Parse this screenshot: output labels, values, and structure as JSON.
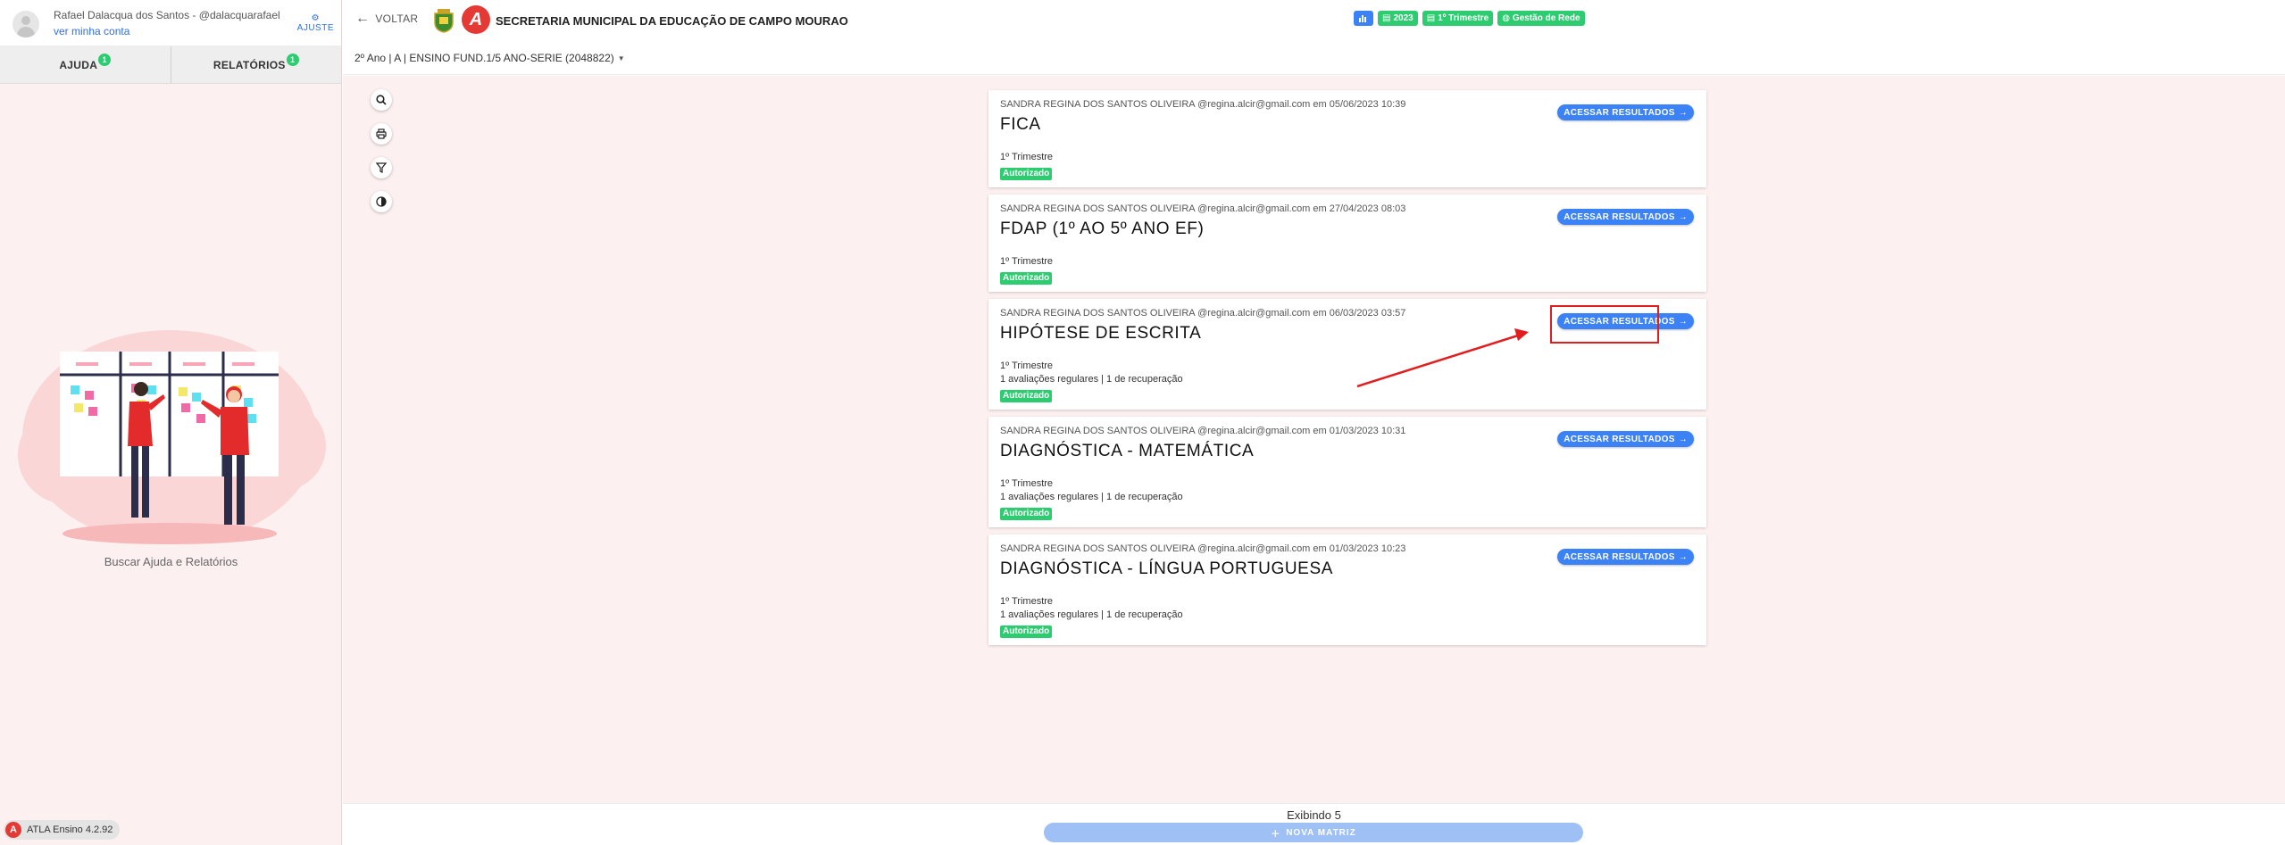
{
  "user": {
    "name": "Rafael Dalacqua dos Santos - @dalacquarafael",
    "account_link": "ver minha conta",
    "settings_label": "AJUSTE"
  },
  "sidebar": {
    "tabs": [
      {
        "label": "AJUDA",
        "badge": "1"
      },
      {
        "label": "RELATÓRIOS",
        "badge": "1"
      }
    ],
    "help_caption": "Buscar Ajuda e Relatórios",
    "version": "ATLA Ensino 4.2.92"
  },
  "header": {
    "back_label": "VOLTAR",
    "org_logo_letter": "A",
    "org_name": "SECRETARIA MUNICIPAL DA EDUCAÇÃO DE CAMPO MOURAO",
    "chips": [
      {
        "label": "",
        "icon": "chart-icon",
        "color": "#3b82f6"
      },
      {
        "label": "2023",
        "icon": "calendar-icon",
        "color": "#2ecc71"
      },
      {
        "label": "1º Trimestre",
        "icon": "calendar-icon",
        "color": "#2ecc71"
      },
      {
        "label": "Gestão de Rede",
        "icon": "globe-icon",
        "color": "#2ecc71"
      }
    ],
    "class_selector": "2º Ano | A | ENSINO FUND.1/5 ANO-SERIE (2048822)"
  },
  "tools": [
    "search-icon",
    "print-icon",
    "filter-icon",
    "contrast-icon"
  ],
  "cards": [
    {
      "meta": "SANDRA REGINA DOS SANTOS OLIVEIRA @regina.alcir@gmail.com em 05/06/2023 10:39",
      "title": "FICA",
      "period": "1º Trimestre",
      "assessments": "",
      "status": "Autorizado",
      "button": "ACESSAR RESULTADOS"
    },
    {
      "meta": "SANDRA REGINA DOS SANTOS OLIVEIRA @regina.alcir@gmail.com em 27/04/2023 08:03",
      "title": "FDAP (1º AO 5º ANO EF)",
      "period": "1º Trimestre",
      "assessments": "",
      "status": "Autorizado",
      "button": "ACESSAR RESULTADOS"
    },
    {
      "meta": "SANDRA REGINA DOS SANTOS OLIVEIRA @regina.alcir@gmail.com em 06/03/2023 03:57",
      "title": "HIPÓTESE DE ESCRITA",
      "period": "1º Trimestre",
      "assessments": "1 avaliações regulares | 1 de recuperação",
      "status": "Autorizado",
      "button": "ACESSAR RESULTADOS"
    },
    {
      "meta": "SANDRA REGINA DOS SANTOS OLIVEIRA @regina.alcir@gmail.com em 01/03/2023 10:31",
      "title": "DIAGNÓSTICA - MATEMÁTICA",
      "period": "1º Trimestre",
      "assessments": "1 avaliações regulares | 1 de recuperação",
      "status": "Autorizado",
      "button": "ACESSAR RESULTADOS"
    },
    {
      "meta": "SANDRA REGINA DOS SANTOS OLIVEIRA @regina.alcir@gmail.com em 01/03/2023 10:23",
      "title": "DIAGNÓSTICA - LÍNGUA PORTUGUESA",
      "period": "1º Trimestre",
      "assessments": "1 avaliações regulares | 1 de recuperação",
      "status": "Autorizado",
      "button": "ACESSAR RESULTADOS"
    }
  ],
  "footer": {
    "showing": "Exibindo 5",
    "new_matrix": "NOVA MATRIZ"
  },
  "colors": {
    "accent": "#3b82f6",
    "success": "#2ecc71",
    "brand_red": "#e53935",
    "annotation_red": "#e11d1d",
    "page_bg": "#fdf0f0"
  }
}
